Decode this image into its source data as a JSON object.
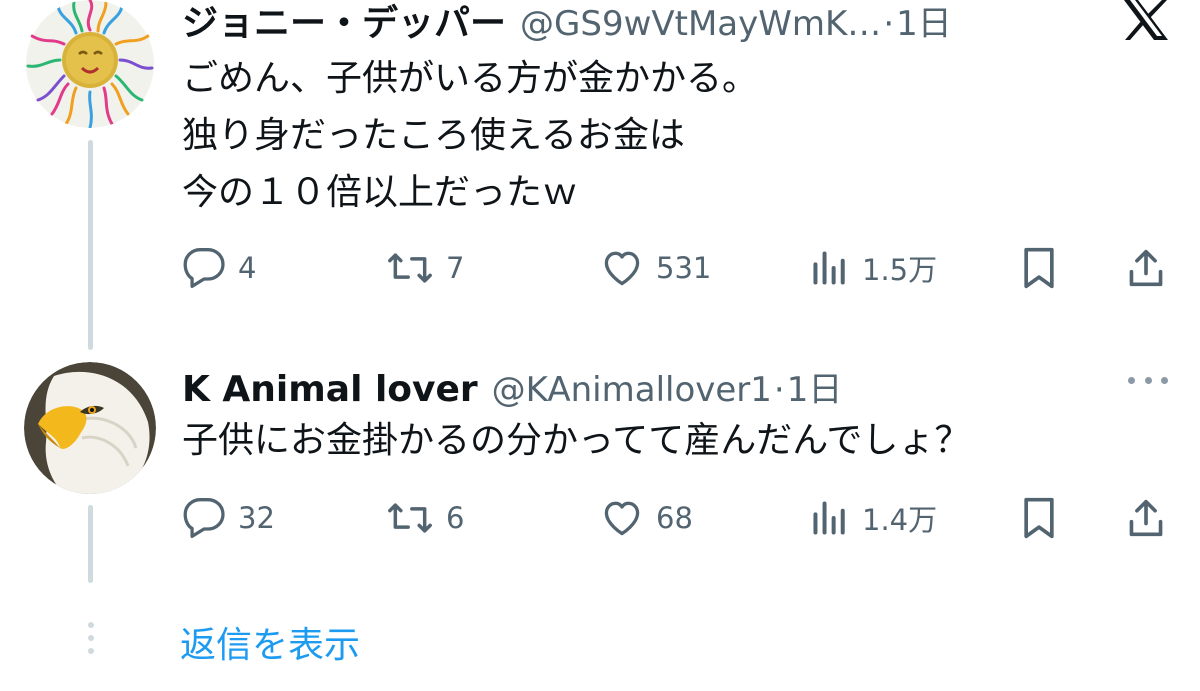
{
  "tweets": [
    {
      "display_name": "ジョニー・デッパー",
      "handle": "@GS9wVtMayWmK…",
      "separator": "·",
      "time": "1日",
      "lines": [
        "ごめん、子供がいる方が金かかる。",
        "独り身だったころ使えるお金は",
        "今の１０倍以上だったｗ"
      ],
      "actions": {
        "replies": "4",
        "retweets": "7",
        "likes": "531",
        "views": "1.5万"
      }
    },
    {
      "display_name": "K Animal lover",
      "handle": "@KAnimallover1",
      "separator": "·",
      "time": "1日",
      "lines": [
        "子供にお金掛かるの分かってて産んだんでしょ？"
      ],
      "actions": {
        "replies": "32",
        "retweets": "6",
        "likes": "68",
        "views": "1.4万"
      }
    }
  ],
  "show_replies_label": "返信を表示",
  "icons": {
    "brand": "x-logo-icon",
    "reply": "reply-icon",
    "retweet": "retweet-icon",
    "like": "heart-icon",
    "views": "views-icon",
    "bookmark": "bookmark-icon",
    "share": "share-icon",
    "more": "more-icon"
  },
  "colors": {
    "text": "#0f1419",
    "secondary": "#536471",
    "link": "#1d9bf0",
    "thread_line": "#cfd9de"
  }
}
